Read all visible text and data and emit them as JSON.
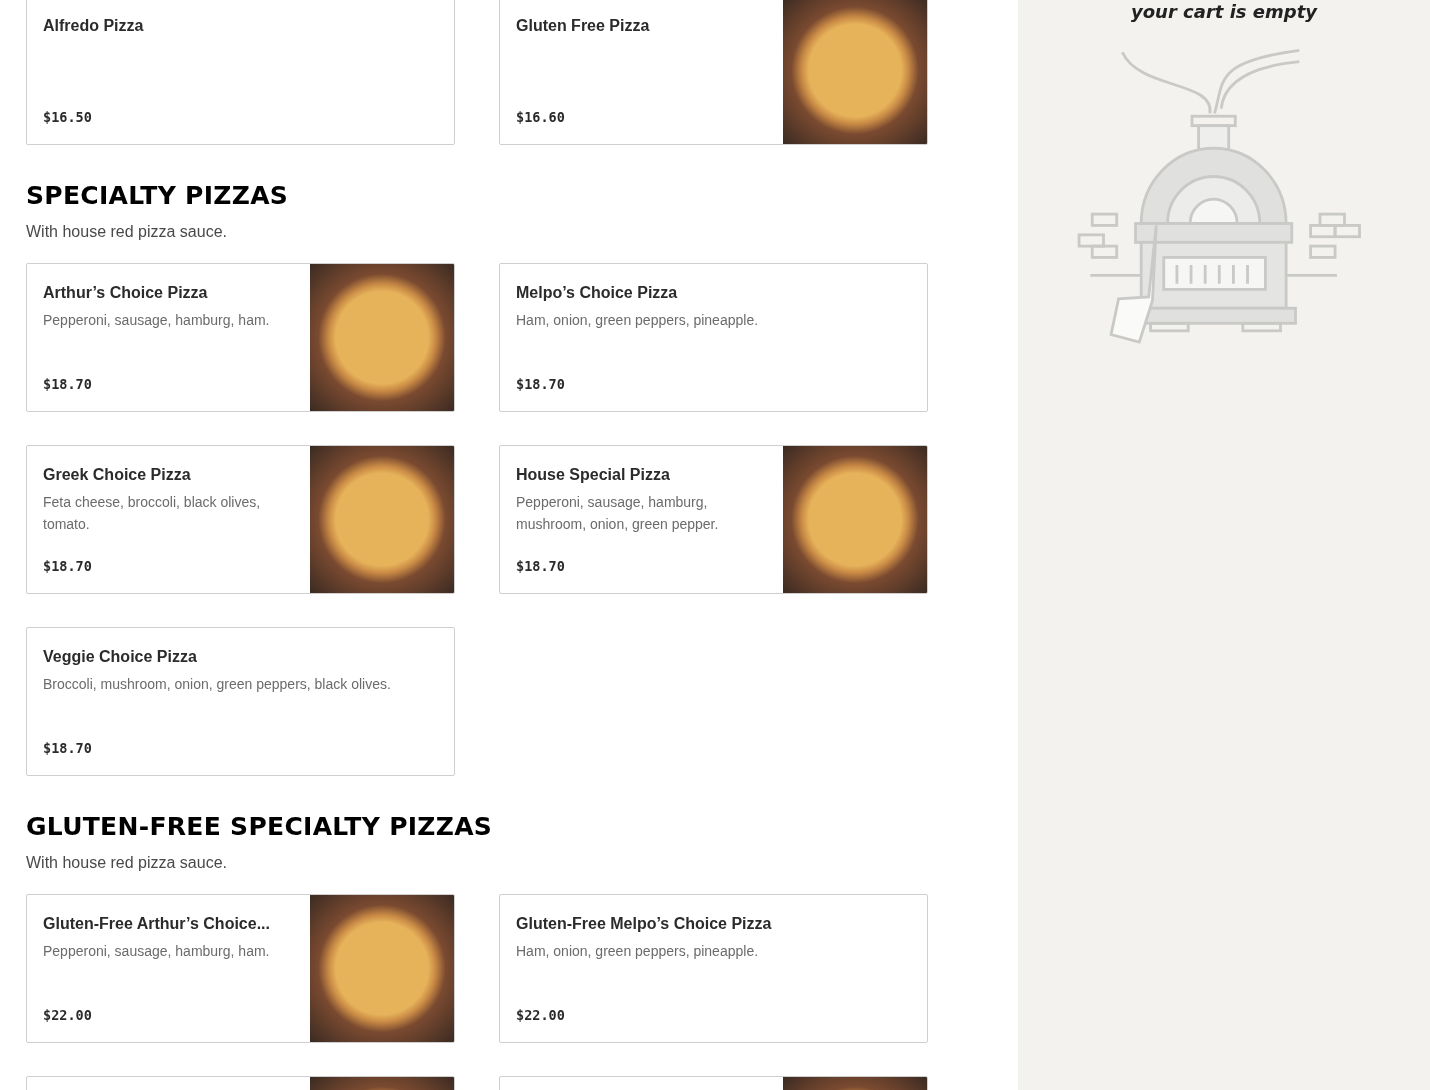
{
  "sections": [
    {
      "items": [
        {
          "name": "Alfredo Pizza",
          "price": "$16.50",
          "photo": false
        },
        {
          "name": "Gluten Free Pizza",
          "price": "$16.60",
          "photo": true
        }
      ]
    },
    {
      "heading": "SPECIALTY PIZZAS",
      "subtitle": "With house red pizza sauce.",
      "items": [
        {
          "name": "Arthur’s Choice Pizza",
          "description": "Pepperoni, sausage, hamburg, ham.",
          "price": "$18.70",
          "photo": true
        },
        {
          "name": "Melpo’s Choice Pizza",
          "description": "Ham, onion, green peppers, pineapple.",
          "price": "$18.70",
          "photo": false
        },
        {
          "name": "Greek Choice Pizza",
          "description": "Feta cheese, broccoli, black olives, tomato.",
          "price": "$18.70",
          "photo": true
        },
        {
          "name": "House Special Pizza",
          "description": "Pepperoni, sausage, hamburg, mushroom, onion, green pepper.",
          "price": "$18.70",
          "photo": true
        },
        {
          "name": "Veggie Choice Pizza",
          "description": "Broccoli, mushroom, onion, green peppers, black olives.",
          "price": "$18.70",
          "photo": false
        }
      ]
    },
    {
      "heading": "GLUTEN-FREE SPECIALTY PIZZAS",
      "subtitle": "With house red pizza sauce.",
      "items": [
        {
          "name": "Gluten-Free Arthur’s Choice...",
          "description": "Pepperoni, sausage, hamburg, ham.",
          "price": "$22.00",
          "photo": true
        },
        {
          "name": "Gluten-Free Melpo’s Choice Pizza",
          "description": "Ham, onion, green peppers, pineapple.",
          "price": "$22.00",
          "photo": false
        },
        {
          "photo": true
        },
        {
          "photo": true
        }
      ]
    }
  ],
  "cart": {
    "empty_message": "your cart is empty"
  }
}
